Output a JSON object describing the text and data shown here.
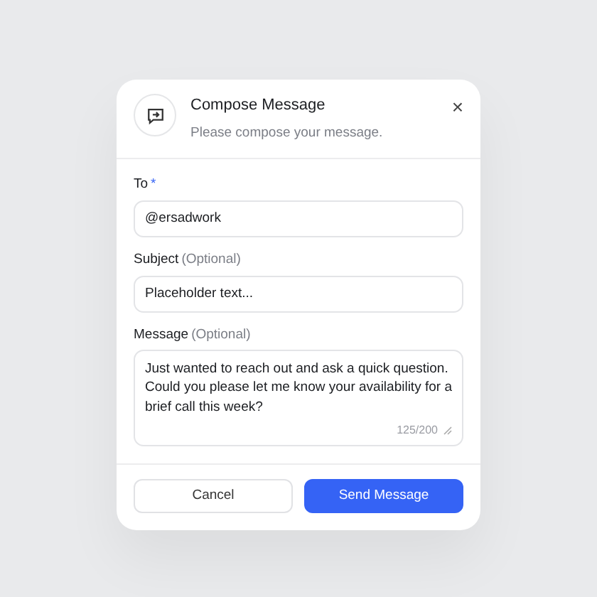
{
  "dialog": {
    "title": "Compose Message",
    "subtitle": "Please compose your message.",
    "close": "×"
  },
  "fields": [
    {
      "kind": "input",
      "label": "To",
      "required_mark": "*",
      "value": "@ersadwork"
    },
    {
      "kind": "input",
      "label": "Subject",
      "hint": "(Optional)",
      "value": "Placeholder text..."
    },
    {
      "kind": "textarea",
      "label": "Message",
      "hint": "(Optional)",
      "value": "Just wanted to reach out and ask a quick question. Could you please let me know your availability for a brief call this week?",
      "counter": "125/200"
    }
  ],
  "buttons": [
    {
      "label": "Cancel",
      "kind": "secondary"
    },
    {
      "label": "Send Message",
      "kind": "primary"
    }
  ]
}
